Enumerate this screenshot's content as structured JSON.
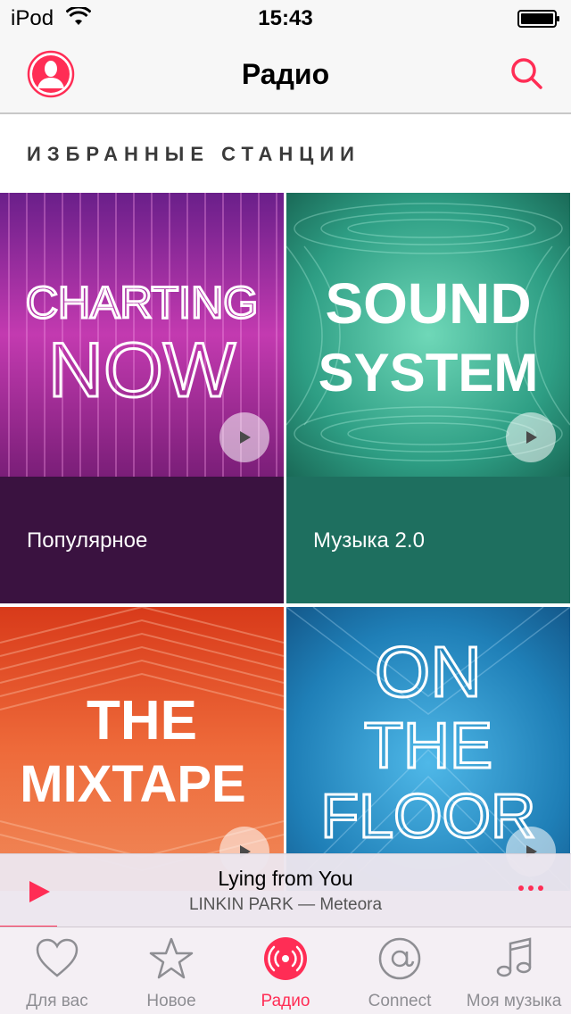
{
  "status_bar": {
    "carrier": "iPod",
    "time": "15:43"
  },
  "nav": {
    "title": "Радио"
  },
  "section": {
    "title": "ИЗБРАННЫЕ СТАНЦИИ"
  },
  "stations": [
    {
      "art_lines": [
        "CHARTING",
        "NOW"
      ],
      "label": "Популярное",
      "caption_color": "#3a1240",
      "accent": "#b43aa6"
    },
    {
      "art_lines": [
        "SOUND",
        "SYSTEM"
      ],
      "label": "Музыка 2.0",
      "caption_color": "#1e6f5f",
      "accent": "#2e9e84"
    },
    {
      "art_lines": [
        "THE",
        "MIXTAPE"
      ],
      "label": "",
      "accent": "#e9572a"
    },
    {
      "art_lines": [
        "ON",
        "THE",
        "FLOOR"
      ],
      "label": "",
      "accent": "#1f7fb7"
    }
  ],
  "mini_player": {
    "track": "Lying from You",
    "artist_album": "LINKIN PARK — Meteora",
    "progress": 0.1
  },
  "tabs": [
    {
      "label": "Для вас",
      "icon": "heart-icon",
      "active": false
    },
    {
      "label": "Новое",
      "icon": "star-icon",
      "active": false
    },
    {
      "label": "Радио",
      "icon": "radio-icon",
      "active": true
    },
    {
      "label": "Connect",
      "icon": "at-icon",
      "active": false
    },
    {
      "label": "Моя музыка",
      "icon": "music-note-icon",
      "active": false
    }
  ],
  "colors": {
    "accent": "#ff2d55"
  }
}
